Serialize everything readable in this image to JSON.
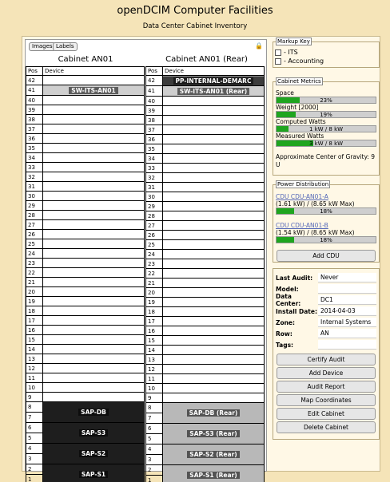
{
  "header": {
    "title": "openDCIM Computer Facilities",
    "subtitle": "Data Center Cabinet Inventory"
  },
  "toolbar": {
    "images_label": "Images",
    "labels_label": "Labels",
    "lock_icon": "lock-icon"
  },
  "cabinet_front": {
    "title": "Cabinet AN01",
    "col_pos": "Pos",
    "col_device": "Device",
    "devices": [
      {
        "label": "SW-ITS-AN01"
      },
      {
        "label": "SAP-DB"
      },
      {
        "label": "SAP-S3"
      },
      {
        "label": "SAP-S2"
      },
      {
        "label": "SAP-S1"
      }
    ]
  },
  "cabinet_rear": {
    "title": "Cabinet AN01 (Rear)",
    "col_pos": "Pos",
    "col_device": "Device",
    "devices": [
      {
        "label": "PP-INTERNAL-DEMARC"
      },
      {
        "label": "SW-ITS-AN01 (Rear)"
      },
      {
        "label": "SAP-DB (Rear)"
      },
      {
        "label": "SAP-S3 (Rear)"
      },
      {
        "label": "SAP-S2 (Rear)"
      },
      {
        "label": "SAP-S1 (Rear)"
      }
    ]
  },
  "markup_key": {
    "legend": "Markup Key",
    "items": [
      {
        "label": "- ITS"
      },
      {
        "label": "- Accounting"
      }
    ]
  },
  "metrics": {
    "legend": "Cabinet Metrics",
    "space_label": "Space",
    "space_text": "23%",
    "space_pct": 23,
    "weight_label": "Weight [2000]",
    "weight_text": "19%",
    "weight_pct": 19,
    "computed_label": "Computed Watts",
    "computed_text": "1 kW / 8 kW",
    "computed_pct": 12,
    "measured_label": "Measured Watts",
    "measured_text": "3 kW / 8 kW",
    "measured_pct": 37,
    "cog": "Approximate Center of Gravity: 9 U"
  },
  "power": {
    "legend": "Power Distribution",
    "cdus": [
      {
        "name": "CDU CDU-AN01-A",
        "detail": "(1.61 kW) / (8.65 kW Max)",
        "text": "18%",
        "pct": 18
      },
      {
        "name": "CDU CDU-AN01-B",
        "detail": "(1.54 kW) / (8.65 kW Max)",
        "text": "18%",
        "pct": 18
      }
    ],
    "add_label": "Add CDU"
  },
  "info": {
    "last_audit_label": "Last Audit:",
    "last_audit": "Never",
    "model_label": "Model:",
    "model": "",
    "dc_label": "Data Center:",
    "dc": "DC1",
    "install_label": "Install Date:",
    "install": "2014-04-03",
    "zone_label": "Zone:",
    "zone": "Internal Systems",
    "row_label": "Row:",
    "row": "AN",
    "tags_label": "Tags:",
    "tags": ""
  },
  "actions": {
    "certify": "Certify Audit",
    "add_device": "Add Device",
    "audit_report": "Audit Report",
    "map": "Map Coordinates",
    "edit": "Edit Cabinet",
    "delete": "Delete Cabinet"
  },
  "colors": {
    "page_bg": "#f5e4b8",
    "bar_fill": "#1fa51f",
    "link": "#5568b8"
  }
}
